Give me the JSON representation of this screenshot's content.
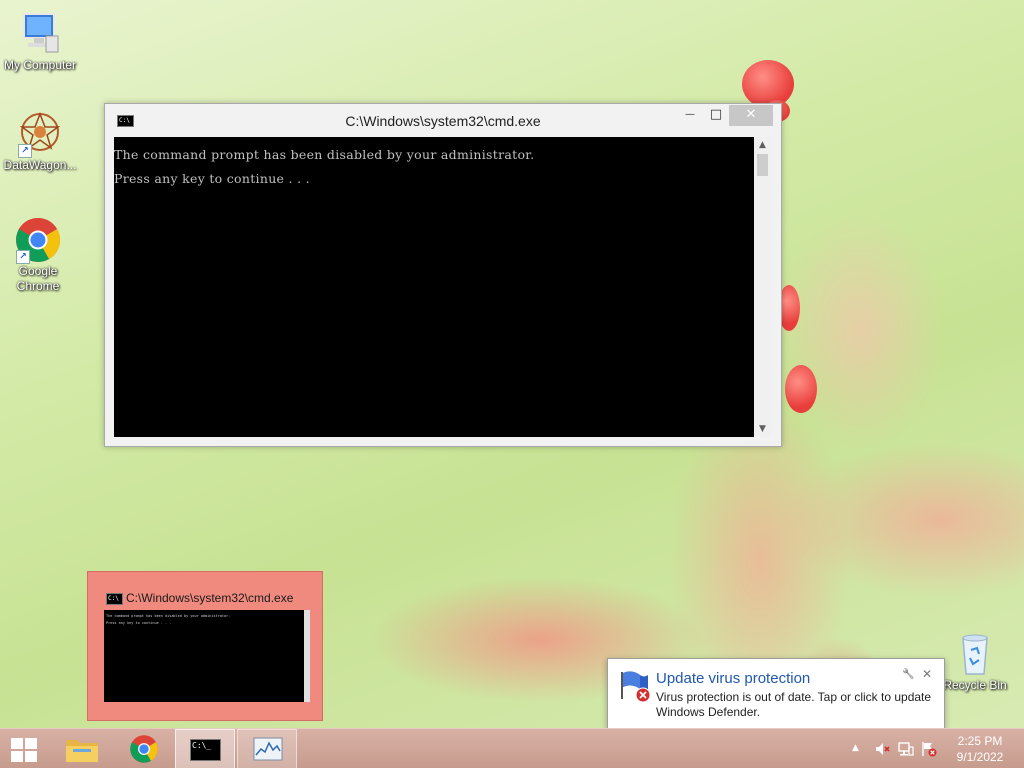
{
  "desktop": {
    "icons": [
      {
        "label": "My Computer"
      },
      {
        "label": "DataWagon..."
      },
      {
        "label": "Google Chrome"
      },
      {
        "label": "Recycle Bin"
      }
    ]
  },
  "cmd_window": {
    "title": "C:\\Windows\\system32\\cmd.exe",
    "icon_text": "C:\\",
    "minimize_glyph": "—",
    "maximize_glyph": "□",
    "close_glyph": "✕",
    "console_lines": [
      "The command prompt has been disabled by your administrator.",
      "Press any key to continue . . ."
    ]
  },
  "thumbnail": {
    "title": "C:\\Windows\\system32\\cmd.exe",
    "lines": [
      "The command prompt has been disabled by your administrator.",
      "Press any key to continue . . ."
    ]
  },
  "notification": {
    "title": "Update virus protection",
    "body": "Virus protection is out of date. Tap or click to update Windows Defender.",
    "pin_glyph": "🔧",
    "close_glyph": "✕"
  },
  "taskbar": {
    "cmd_icon_text": "C:\\_",
    "clock_time": "2:25 PM",
    "clock_date": "9/1/2022",
    "tray_up_arrow": "▲"
  },
  "colors": {
    "taskbar": "#c9a294",
    "console_bg": "#000000",
    "console_text": "#c0c0c0",
    "thumbnail_highlight": "#f08a7e",
    "notification_title": "#2058b0"
  }
}
